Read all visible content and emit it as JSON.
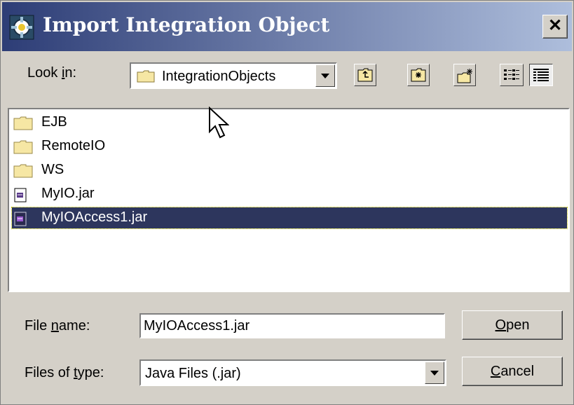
{
  "window": {
    "title": "Import Integration Object",
    "close_glyph": "✕"
  },
  "lookin": {
    "label_pre": "Look ",
    "label_key": "i",
    "label_post": "n:",
    "value": "IntegrationObjects"
  },
  "toolbar": {
    "buttons": [
      "up-one-level-icon",
      "home-icon",
      "new-folder-icon",
      "list-view-icon",
      "details-view-icon"
    ]
  },
  "files": [
    {
      "name": "EJB",
      "type": "folder"
    },
    {
      "name": "RemoteIO",
      "type": "folder"
    },
    {
      "name": "WS",
      "type": "folder"
    },
    {
      "name": "MyIO.jar",
      "type": "jar"
    },
    {
      "name": "MyIOAccess1.jar",
      "type": "jar",
      "selected": true
    }
  ],
  "filename": {
    "label_pre": "File ",
    "label_key": "n",
    "label_post": "ame:",
    "value": "MyIOAccess1.jar"
  },
  "filetype": {
    "label_pre": "Files of ",
    "label_key": "t",
    "label_post": "ype:",
    "value": "Java Files (.jar)"
  },
  "buttons": {
    "open_key": "O",
    "open_rest": "pen",
    "cancel_key": "C",
    "cancel_rest": "ancel"
  },
  "colors": {
    "title_start": "#2d3d76",
    "title_end": "#aebedc",
    "selection": "#2d365d",
    "face": "#d4d0c8"
  }
}
